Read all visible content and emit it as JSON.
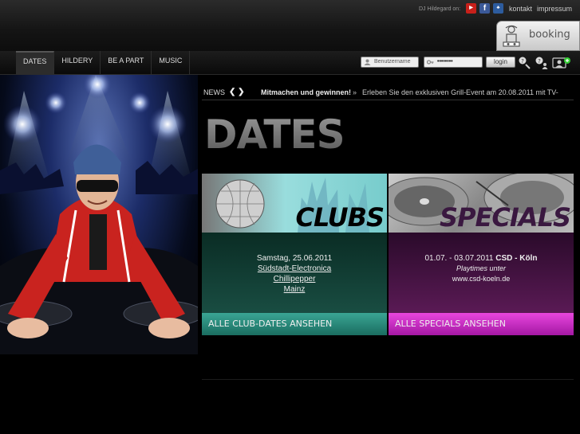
{
  "header": {
    "dj_on": "DJ Hildegard on:",
    "social": [
      {
        "name": "youtube-icon",
        "label": "You Tube",
        "color": "#c8201a"
      },
      {
        "name": "facebook-icon",
        "label": "f",
        "color": "#3b5998"
      },
      {
        "name": "myspace-icon",
        "label": "♣",
        "color": "#2d5c9e"
      }
    ],
    "links": {
      "kontakt": "kontakt",
      "impressum": "impressum"
    },
    "booking": "booking"
  },
  "nav": {
    "items": [
      {
        "label": "DATES",
        "active": true
      },
      {
        "label": "HILDERY",
        "active": false
      },
      {
        "label": "BE A PART",
        "active": false
      },
      {
        "label": "MUSIC",
        "active": false
      }
    ]
  },
  "login": {
    "username_placeholder": "Benutzername",
    "password_value": "••••••••",
    "button": "login"
  },
  "news": {
    "label": "NEWS",
    "arrows": "❮ ❯",
    "headline": "Mitmachen und gewinnen!",
    "separator": "»",
    "text": "Erleben Sie den exklusiven Grill-Event am 20.08.2011 mit TV-"
  },
  "page": {
    "title": "DATES"
  },
  "clubs": {
    "banner_title": "CLUBS",
    "date": "Samstag, 25.06.2011",
    "event": "Südstadt-Electronica",
    "venue": "Chillipepper",
    "city": "Mainz",
    "footer": "ALLE CLUB-DATES ANSEHEN"
  },
  "specials": {
    "banner_title": "SPECIALS",
    "date_range": "01.07. - 03.07.2011",
    "event": "CSD - Köln",
    "note": "Playtimes unter",
    "url": "www.csd-koeln.de",
    "footer": "ALLE SPECIALS ANSEHEN"
  },
  "colors": {
    "clubs_accent": "#2a9d8a",
    "specials_accent": "#d62dcf",
    "background": "#000000"
  }
}
